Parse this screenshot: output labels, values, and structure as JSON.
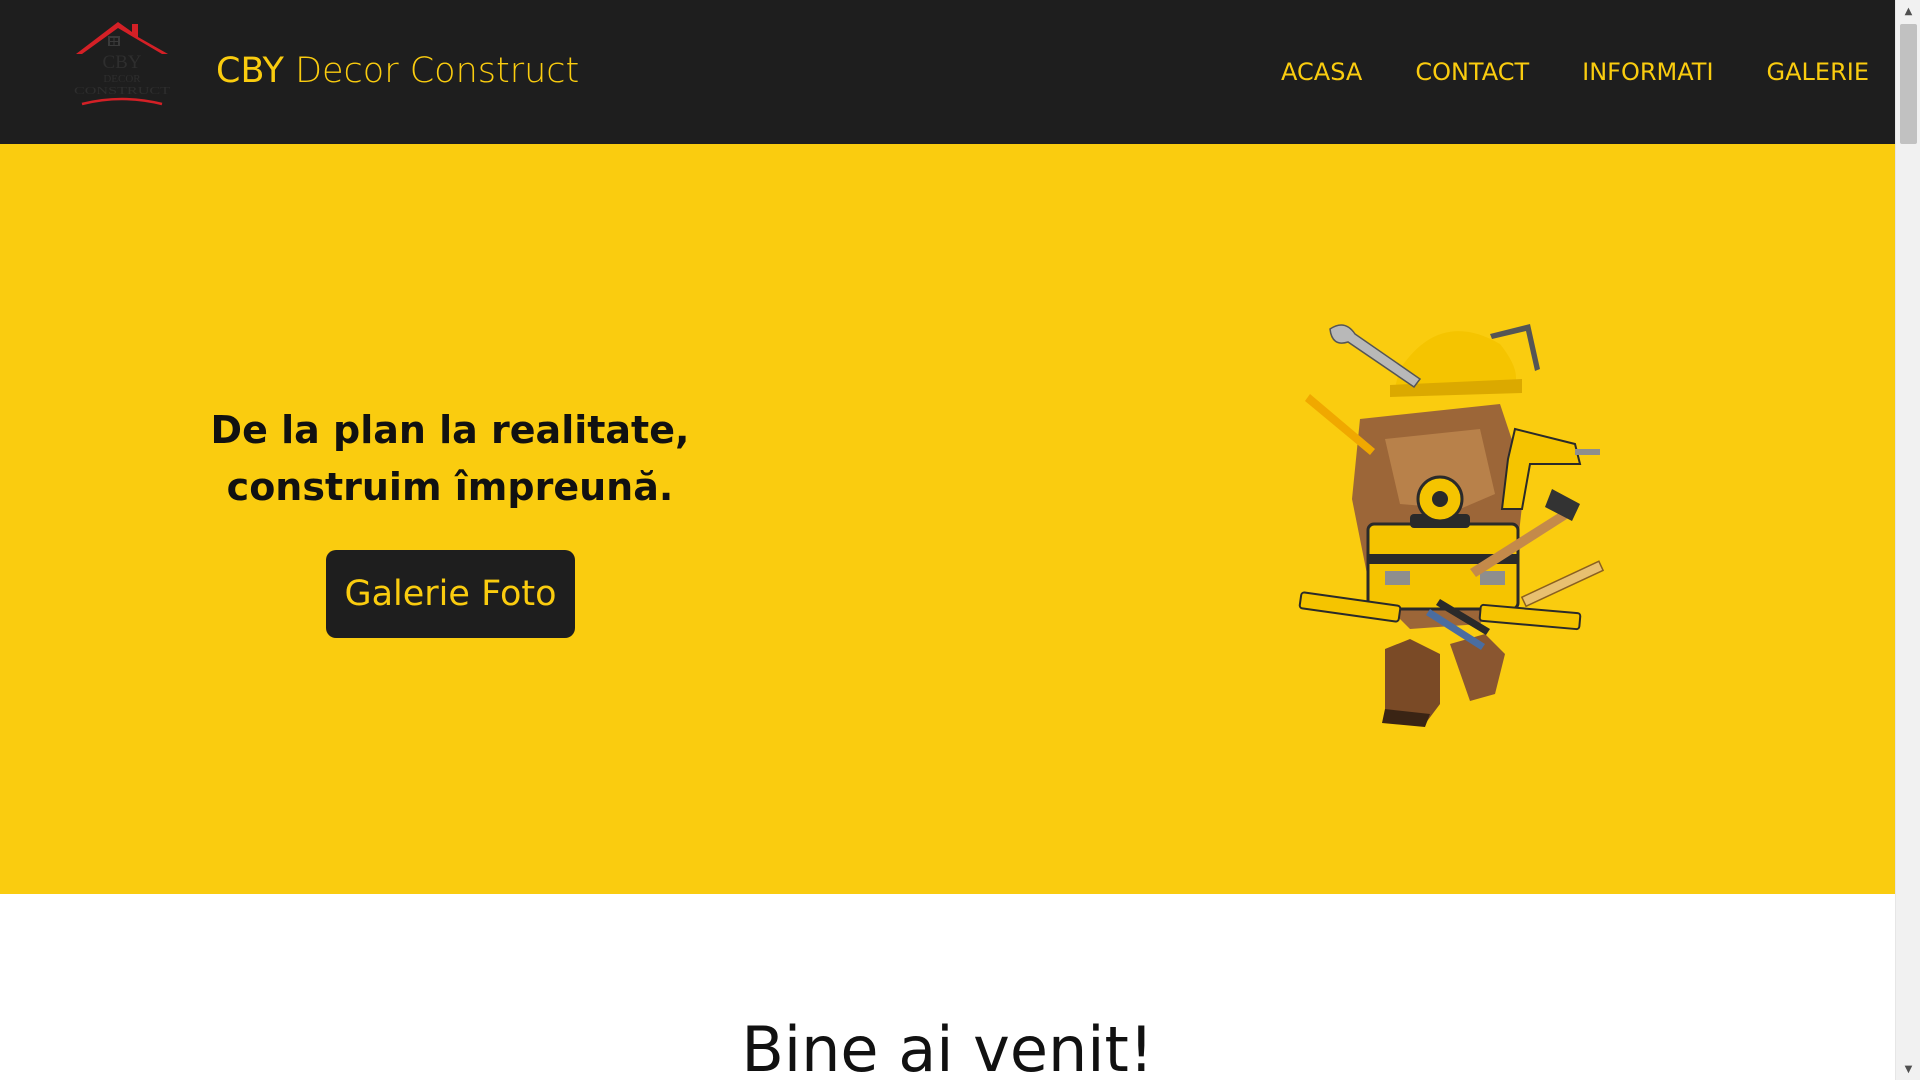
{
  "header": {
    "logo_alt": "CBY Decor Construct logo",
    "logo_text": [
      "CBY",
      "DECOR",
      "CONSTRUCT"
    ],
    "brand_bold": "CBY",
    "brand_light": "Decor Construct",
    "nav": [
      {
        "label": "ACASA"
      },
      {
        "label": "CONTACT"
      },
      {
        "label": "INFORMATI"
      },
      {
        "label": "GALERIE"
      }
    ]
  },
  "hero": {
    "heading_line1": "De la plan la realitate,",
    "heading_line2": "construim împreună.",
    "button_label": "Galerie Foto",
    "illustration": "construction-tools-illustration"
  },
  "welcome": {
    "title": "Bine ai venit!"
  },
  "colors": {
    "accent": "#facc0f",
    "header_bg": "#1e1e1e",
    "text_dark": "#111111"
  }
}
